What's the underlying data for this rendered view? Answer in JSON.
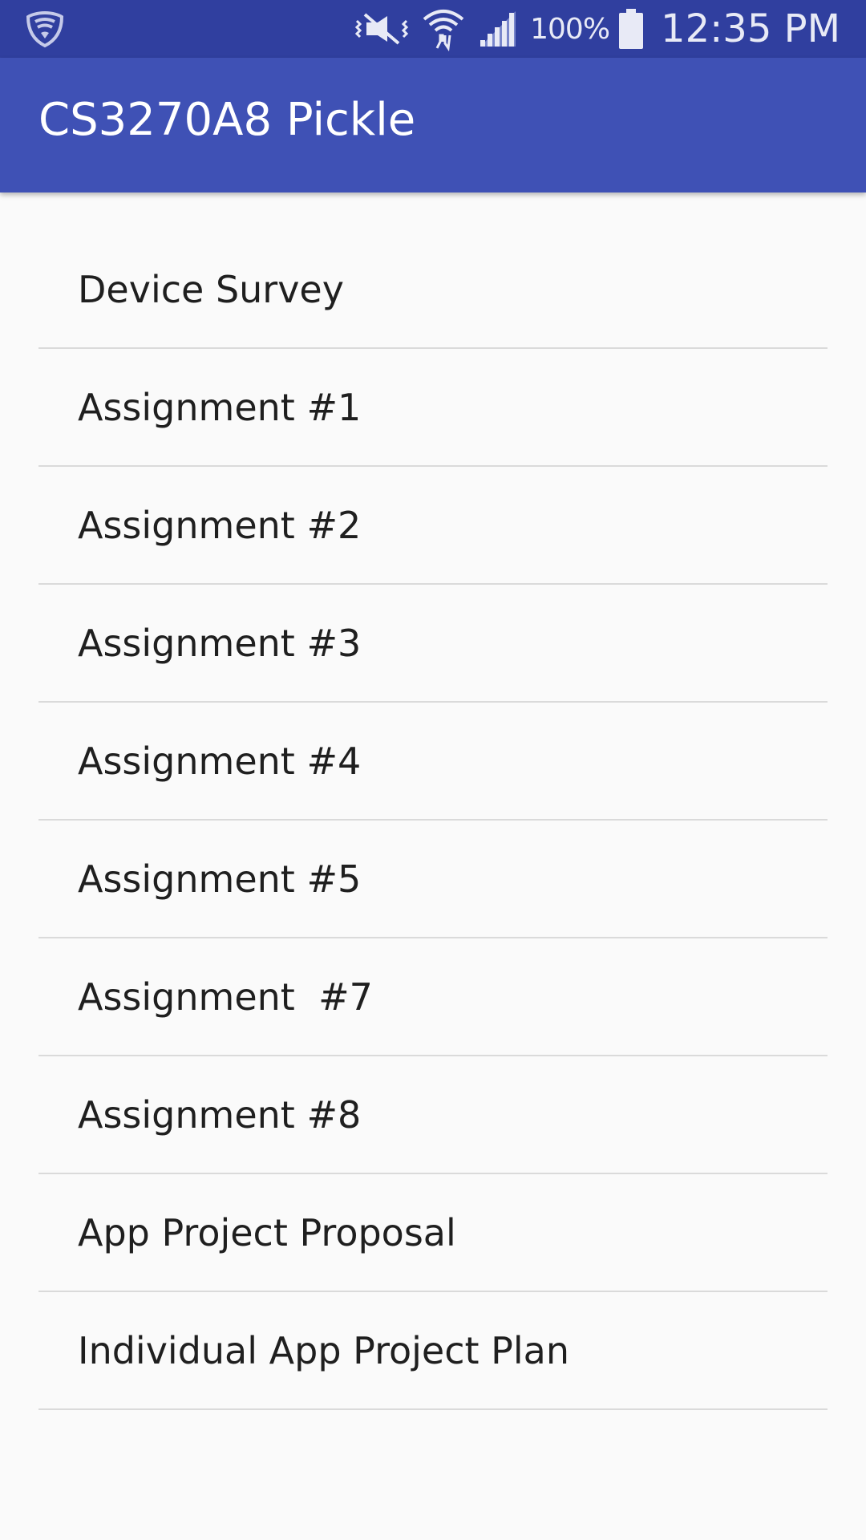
{
  "status_bar": {
    "battery_percent": "100%",
    "time": "12:35 PM",
    "icons": [
      "lookout-shield-icon",
      "vibrate-mute-icon",
      "wifi-icon",
      "cell-signal-icon",
      "battery-icon"
    ]
  },
  "app_bar": {
    "title": "CS3270A8 Pickle"
  },
  "list": {
    "items": [
      {
        "label": "Device Survey"
      },
      {
        "label": "Assignment #1"
      },
      {
        "label": "Assignment #2"
      },
      {
        "label": "Assignment #3"
      },
      {
        "label": "Assignment #4"
      },
      {
        "label": "Assignment #5"
      },
      {
        "label": "Assignment  #7"
      },
      {
        "label": "Assignment #8"
      },
      {
        "label": "App Project Proposal"
      },
      {
        "label": "Individual App Project Plan"
      }
    ]
  },
  "colors": {
    "status_bar": "#303f9f",
    "app_bar": "#3f51b5",
    "background": "#fafafa",
    "divider": "#dadada"
  }
}
